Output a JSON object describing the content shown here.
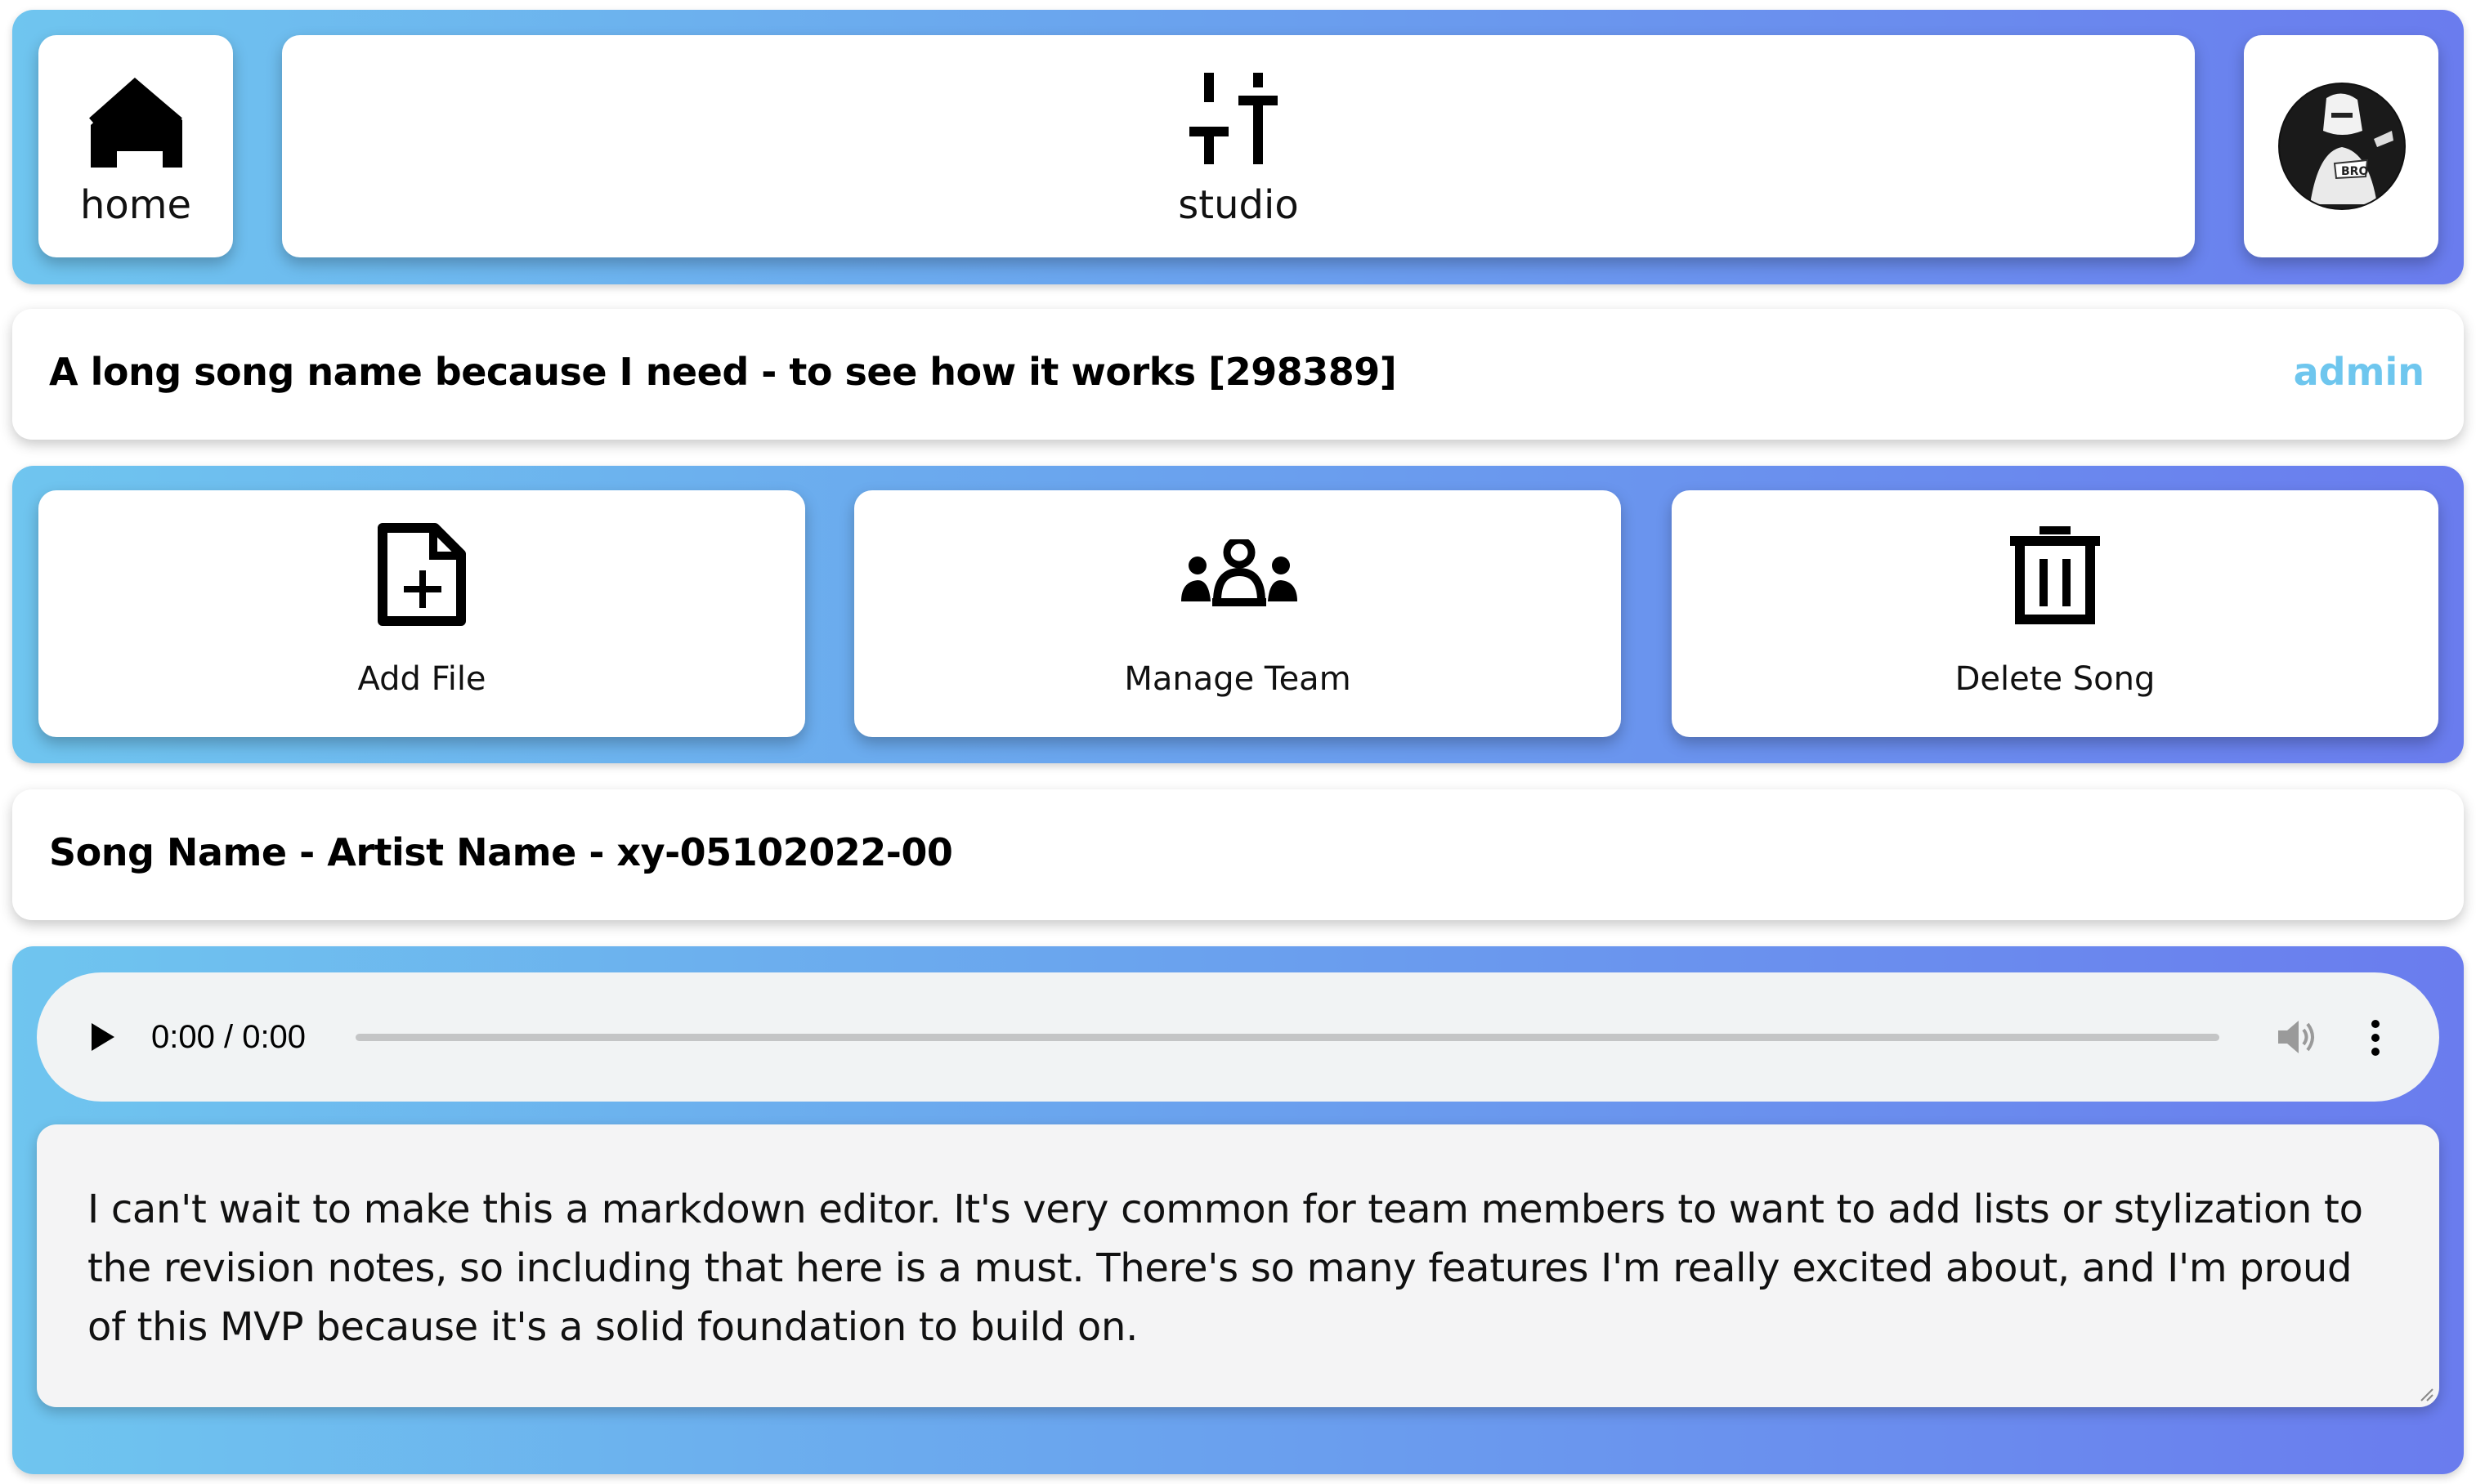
{
  "nav": {
    "home_label": "home",
    "home_icon": "home-icon",
    "studio_label": "studio",
    "studio_icon": "sliders-icon",
    "avatar_icon": "user-avatar"
  },
  "song": {
    "title": "A long song name because I need - to see how it works [298389]",
    "role": "admin"
  },
  "actions": {
    "add_file": "Add File",
    "manage_team": "Manage Team",
    "delete_song": "Delete Song"
  },
  "file": {
    "name": "Song Name - Artist Name - xy-05102022-00"
  },
  "player": {
    "time": "0:00 / 0:00",
    "progress": 0
  },
  "notes": {
    "text": "I can't wait to make this a markdown editor. It's very common for team members to want to add lists or stylization to the revision notes, so including that here is a must. There's so many features I'm really excited about, and I'm proud of this MVP because it's a solid foundation to build on."
  },
  "colors": {
    "gradient_start": "#6fc5ef",
    "gradient_end": "#6a7cee",
    "role_accent": "#6ec6ee",
    "player_bg": "#f1f3f4"
  }
}
